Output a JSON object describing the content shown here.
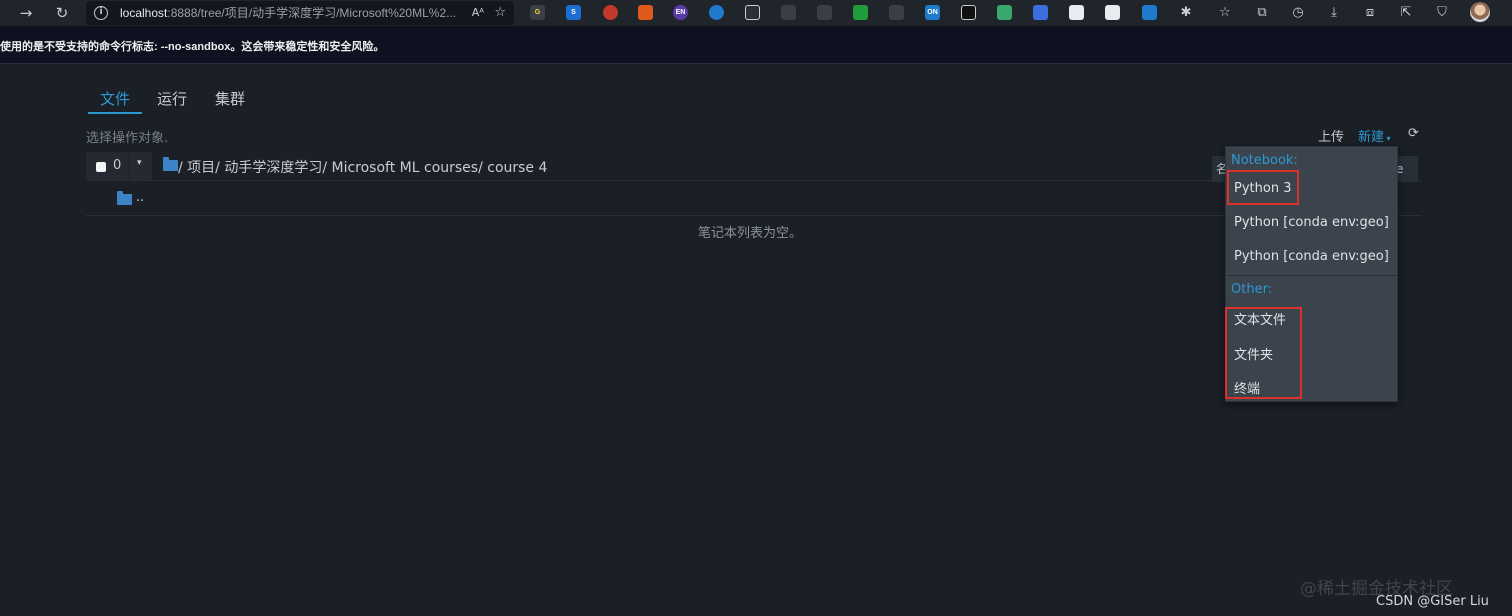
{
  "browser": {
    "url_host": "localhost",
    "url_path": ":8888/tree/项目/动手学深度学习/Microsoft%20ML%2...",
    "read_aloud_label": "Aᴬ"
  },
  "warning": {
    "text": "使用的是不受支持的命令行标志: --no-sandbox。这会带来稳定性和安全风险。"
  },
  "tabs": [
    {
      "label": "文件",
      "active": true
    },
    {
      "label": "运行",
      "active": false
    },
    {
      "label": "集群",
      "active": false
    }
  ],
  "toolbar": {
    "select_hint": "选择操作对象.",
    "upload_label": "上传",
    "new_label": "新建",
    "selected_count": "0"
  },
  "breadcrumb": {
    "text": "/  项目/  动手学深度学习/  Microsoft ML courses/  course 4"
  },
  "list": {
    "parent_label": "..",
    "empty_message": "笔记本列表为空。",
    "sort_label": "名",
    "size_label": "e"
  },
  "dropdown": {
    "notebook_header": "Notebook:",
    "notebook_items": [
      "Python 3",
      "Python [conda env:geo]",
      "Python [conda env:geo]"
    ],
    "other_header": "Other:",
    "other_items": [
      "文本文件",
      "文件夹",
      "终端"
    ]
  },
  "badges": {
    "on_badge": "ON",
    "en_badge": "EN"
  },
  "watermark": {
    "line1": "@稀土掘金技术社区",
    "line2": "CSDN @GISer Liu"
  },
  "colors": {
    "accent": "#2e98d4",
    "background": "#1b1f26",
    "dropdown_bg": "#3b434d",
    "highlight": "#d9312b"
  }
}
